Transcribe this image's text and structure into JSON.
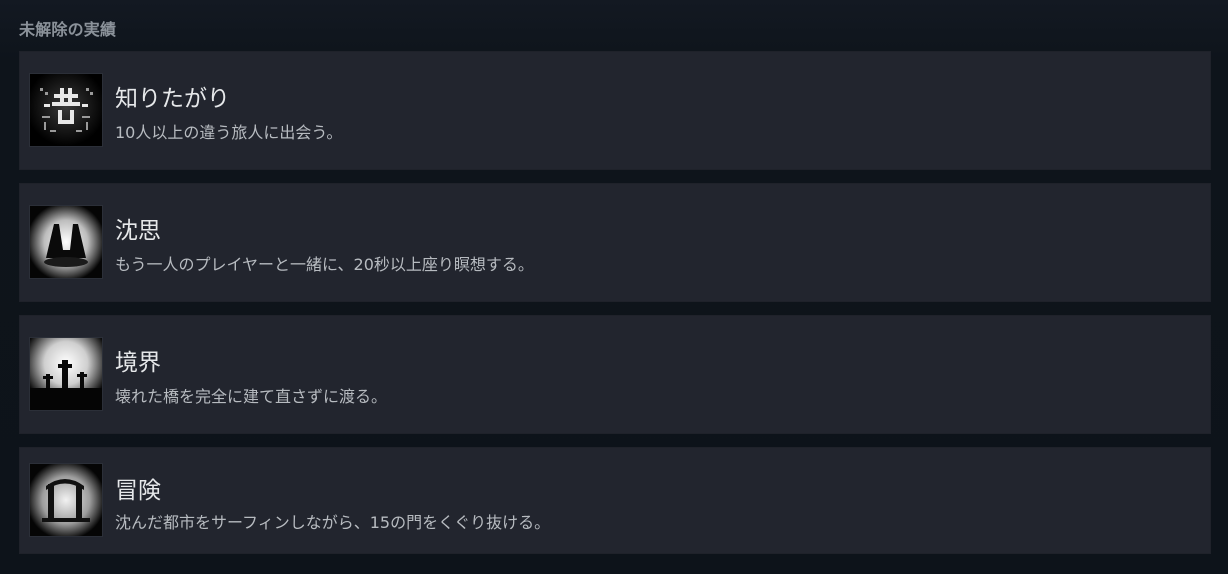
{
  "section": {
    "title": "未解除の実績"
  },
  "achievements": [
    {
      "name": "知りたがり",
      "description": "10人以上の違う旅人に出会う。",
      "icon": "glyph-icon"
    },
    {
      "name": "沈思",
      "description": "もう一人のプレイヤーと一緒に、20秒以上座り瞑想する。",
      "icon": "meditate-icon"
    },
    {
      "name": "境界",
      "description": "壊れた橋を完全に建て直さずに渡る。",
      "icon": "boundary-icon"
    },
    {
      "name": "冒険",
      "description": "沈んだ都市をサーフィンしながら、15の門をくぐり抜ける。",
      "icon": "gate-icon"
    }
  ]
}
